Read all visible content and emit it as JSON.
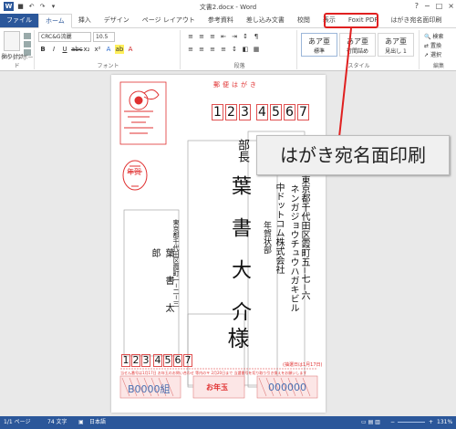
{
  "app": {
    "title": "文書2.docx - Word",
    "logo": "W"
  },
  "window_controls": [
    "?",
    "−",
    "□",
    "×"
  ],
  "tabs": [
    {
      "label": "ファイル"
    },
    {
      "label": "ホーム"
    },
    {
      "label": "挿入"
    },
    {
      "label": "デザイン"
    },
    {
      "label": "ページ レイアウト"
    },
    {
      "label": "参考資料"
    },
    {
      "label": "差し込み文書"
    },
    {
      "label": "校閲"
    },
    {
      "label": "表示"
    },
    {
      "label": "Foxit PDF"
    },
    {
      "label": "はがき宛名面印刷"
    }
  ],
  "ribbon": {
    "clipboard": {
      "label": "クリップボード",
      "paste": "貼り付け"
    },
    "font": {
      "label": "フォント",
      "font_name": "CRC&G流麗",
      "font_size": "10.5"
    },
    "paragraph": {
      "label": "段落"
    },
    "styles": {
      "label": "スタイル",
      "items": [
        {
          "preview": "あア亜",
          "name": "標準"
        },
        {
          "preview": "あア亜",
          "name": "行間詰め"
        },
        {
          "preview": "あア亜",
          "name": "見出し 1"
        }
      ]
    },
    "editing": {
      "label": "編集",
      "items": [
        "検索",
        "置換",
        "選択"
      ]
    }
  },
  "callout": "はがき宛名面印刷",
  "postcard": {
    "header": "郵便はがき",
    "recipient_zip": [
      "1",
      "2",
      "3",
      "4",
      "5",
      "6",
      "7"
    ],
    "recipient_address_line1": "東京都千代田区霞町五−七−六",
    "recipient_address_line2": "ネンガジョウチュウハガキビル",
    "recipient_company": "中ドットコム株式会社",
    "recipient_department": "年賀状部",
    "recipient_title": "部長",
    "recipient_name": "葉書大介",
    "honorific": "様",
    "sender_address": "東京都千代田区霞町一−二−三",
    "sender_name": "葉書太郎",
    "sender_zip": [
      "1",
      "2",
      "3",
      "4",
      "5",
      "6",
      "7"
    ],
    "stamp_text": "年賀",
    "lottery_label_left": "B0000組",
    "lottery_label_right": "000000",
    "lottery_center": "お年玉",
    "footer_note": "(抽選日は1月17日)",
    "small_print": "当せん番号は1月17日 お年玉のお問い合わせ 等内の〒 2月20日まで 当選番号を切り取り引き換えをお願いします"
  },
  "status": {
    "page": "1/1 ページ",
    "words": "74 文字",
    "language": "日本語",
    "zoom": "131%"
  },
  "colors": {
    "accent": "#2b579a",
    "postal_red": "#e03030",
    "highlight_red": "#e02020"
  }
}
